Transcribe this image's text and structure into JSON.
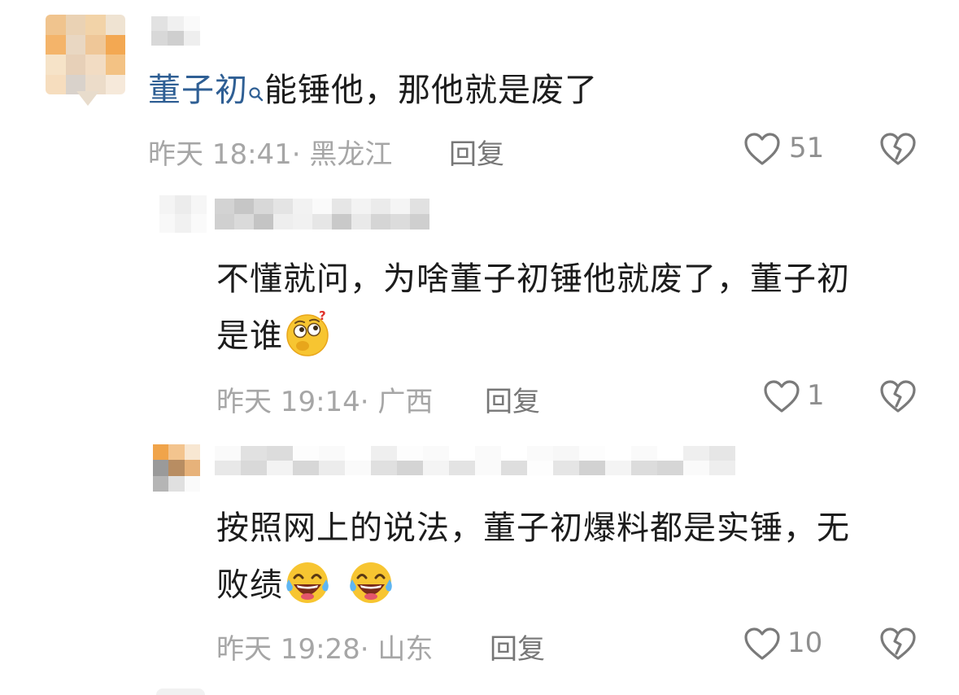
{
  "comments": [
    {
      "mention": "董子初",
      "text": "能锤他，那他就是废了",
      "meta": "昨天 18:41· 黑龙江",
      "reply_label": "回复",
      "likes": "51"
    },
    {
      "text_line1": "不懂就问，为啥董子初锤他就废了，董子初",
      "text_line2": "是谁",
      "meta": "昨天 19:14· 广西",
      "reply_label": "回复",
      "likes": "1"
    },
    {
      "text_line1": "按照网上的说法，董子初爆料都是实锤，无",
      "text_line2": "败绩",
      "meta": "昨天 19:28· 山东",
      "reply_label": "回复",
      "likes": "10"
    }
  ],
  "icons": {
    "like": "heart-outline-icon",
    "dislike": "broken-heart-icon",
    "mention_search": "search-icon",
    "emoji_thinking": "thinking-face-emoji",
    "emoji_laugh": "tears-of-joy-emoji"
  },
  "colors": {
    "mention": "#2f5f94",
    "meta": "#a6a6a6",
    "icon": "#7a7a7a"
  }
}
